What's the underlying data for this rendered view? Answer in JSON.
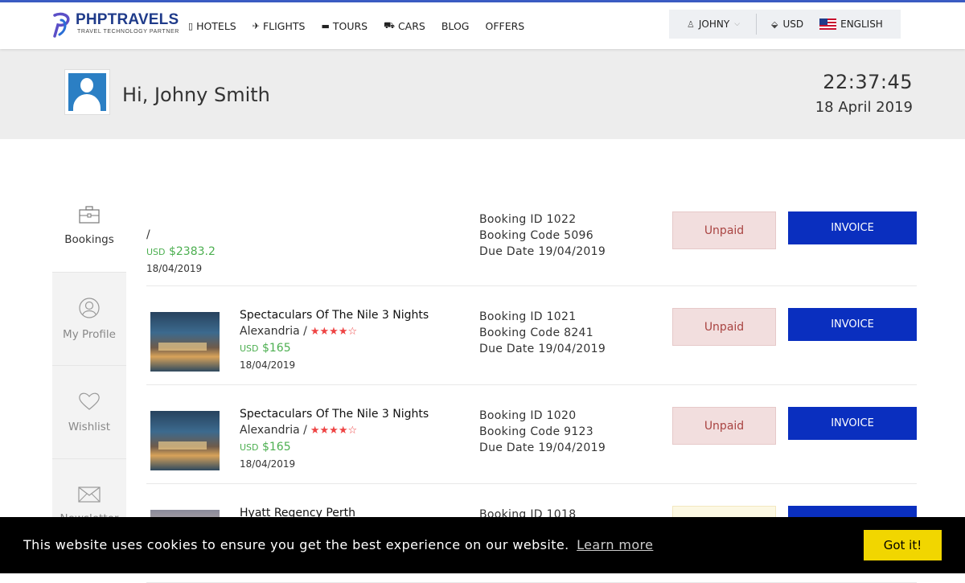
{
  "brand": {
    "name": "PHPTRAVELS",
    "tagline": "TRAVEL TECHNOLOGY PARTNER"
  },
  "nav": {
    "links": [
      {
        "label": "HOTELS",
        "icon": "building-icon"
      },
      {
        "label": "FLIGHTS",
        "icon": "plane-icon"
      },
      {
        "label": "TOURS",
        "icon": "suitcase-icon"
      },
      {
        "label": "CARS",
        "icon": "car-icon"
      },
      {
        "label": "BLOG",
        "icon": ""
      },
      {
        "label": "OFFERS",
        "icon": ""
      }
    ],
    "user": "JOHNY",
    "currency": "USD",
    "language": "ENGLISH"
  },
  "hero": {
    "greeting": "Hi, Johny Smith",
    "time": "22:37:45",
    "date": "18 April 2019"
  },
  "sidebar": {
    "items": [
      {
        "label": "Bookings",
        "icon": "briefcase-icon",
        "active": true
      },
      {
        "label": "My Profile",
        "icon": "user-circle-icon",
        "active": false
      },
      {
        "label": "Wishlist",
        "icon": "heart-icon",
        "active": false
      },
      {
        "label": "Newsletter",
        "icon": "envelope-icon",
        "active": false
      }
    ]
  },
  "bookings": [
    {
      "name": "",
      "location": "/",
      "currency": "USD",
      "price": "$2383.2",
      "date": "18/04/2019",
      "booking_id": "Booking ID 1022",
      "booking_code": "Booking Code 5096",
      "due_date": "Due Date 19/04/2019",
      "status": "Unpaid",
      "invoice": "INVOICE"
    },
    {
      "name": "Spectaculars Of The Nile 3 Nights",
      "location": "Alexandria /",
      "stars": "★★★★☆",
      "currency": "USD",
      "price": "$165",
      "date": "18/04/2019",
      "booking_id": "Booking ID 1021",
      "booking_code": "Booking Code 8241",
      "due_date": "Due Date 19/04/2019",
      "status": "Unpaid",
      "invoice": "INVOICE"
    },
    {
      "name": "Spectaculars Of The Nile 3 Nights",
      "location": "Alexandria /",
      "stars": "★★★★☆",
      "currency": "USD",
      "price": "$165",
      "date": "18/04/2019",
      "booking_id": "Booking ID 1020",
      "booking_code": "Booking Code 9123",
      "due_date": "Due Date 19/04/2019",
      "status": "Unpaid",
      "invoice": "INVOICE"
    },
    {
      "name": "Hyatt Regency Perth",
      "booking_id": "Booking ID 1018"
    }
  ],
  "cookie": {
    "message": "This website uses cookies to ensure you get the best experience on our website.",
    "link": "Learn more",
    "button": "Got it!"
  }
}
